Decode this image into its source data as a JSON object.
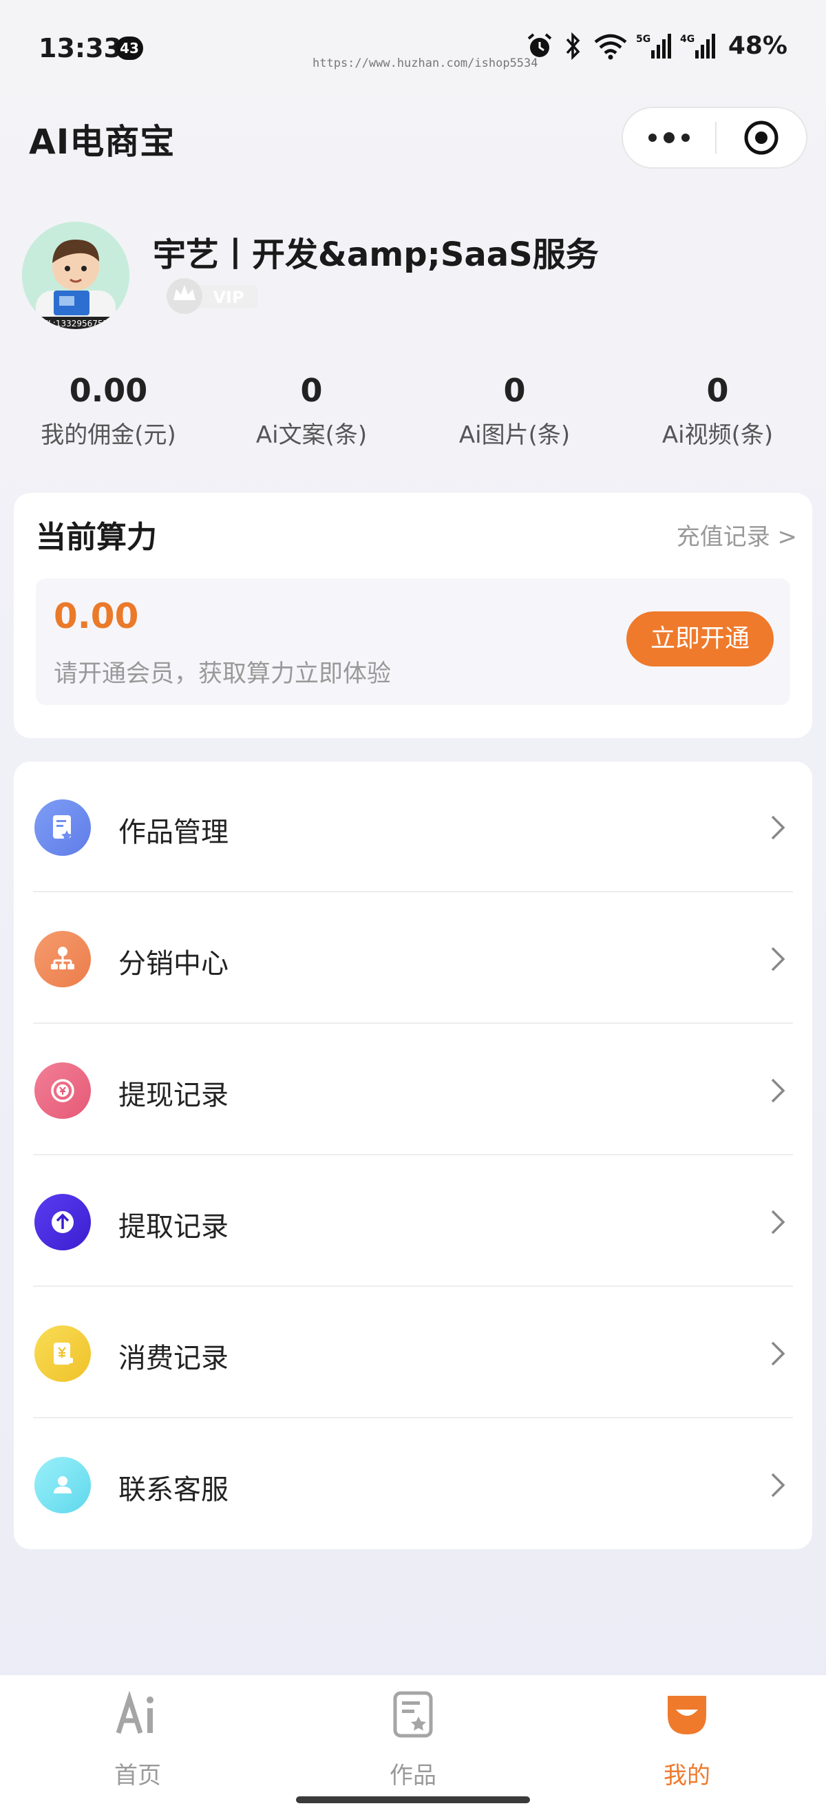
{
  "status_bar": {
    "time": "13:33",
    "notification_count": "43",
    "watermark": "https://www.huzhan.com/ishop5534",
    "battery": "48%",
    "network_5g": "5G",
    "network_4g": "4G"
  },
  "header": {
    "title": "AI电商宝"
  },
  "profile": {
    "nickname": "宇艺丨开发&amp;SaaS服务",
    "vip_label": "VIP",
    "avatar_caption": "TEL:13329567577"
  },
  "stats": [
    {
      "value": "0.00",
      "label": "我的佣金(元)"
    },
    {
      "value": "0",
      "label": "Ai文案(条)"
    },
    {
      "value": "0",
      "label": "Ai图片(条)"
    },
    {
      "value": "0",
      "label": "Ai视频(条)"
    }
  ],
  "power": {
    "title": "当前算力",
    "recharge_link": "充值记录 >",
    "value": "0.00",
    "hint": "请开通会员，获取算力立即体验",
    "open_button": "立即开通"
  },
  "menu": [
    {
      "label": "作品管理",
      "icon": "works-icon",
      "color": "#6f8ef0"
    },
    {
      "label": "分销中心",
      "icon": "distribution-icon",
      "color": "#f08a5a"
    },
    {
      "label": "提现记录",
      "icon": "withdraw-icon",
      "color": "#ee6b86"
    },
    {
      "label": "提取记录",
      "icon": "upload-icon",
      "color": "#4b2ee0"
    },
    {
      "label": "消费记录",
      "icon": "expense-icon",
      "color": "#f4cf3a"
    },
    {
      "label": "联系客服",
      "icon": "customer-service-icon",
      "color": "#76e3f2"
    }
  ],
  "tabbar": {
    "items": [
      {
        "label": "首页",
        "icon": "ai-home-icon"
      },
      {
        "label": "作品",
        "icon": "works-tab-icon"
      },
      {
        "label": "我的",
        "icon": "mine-icon",
        "active": true
      }
    ],
    "active_color": "#ef7a2c"
  }
}
